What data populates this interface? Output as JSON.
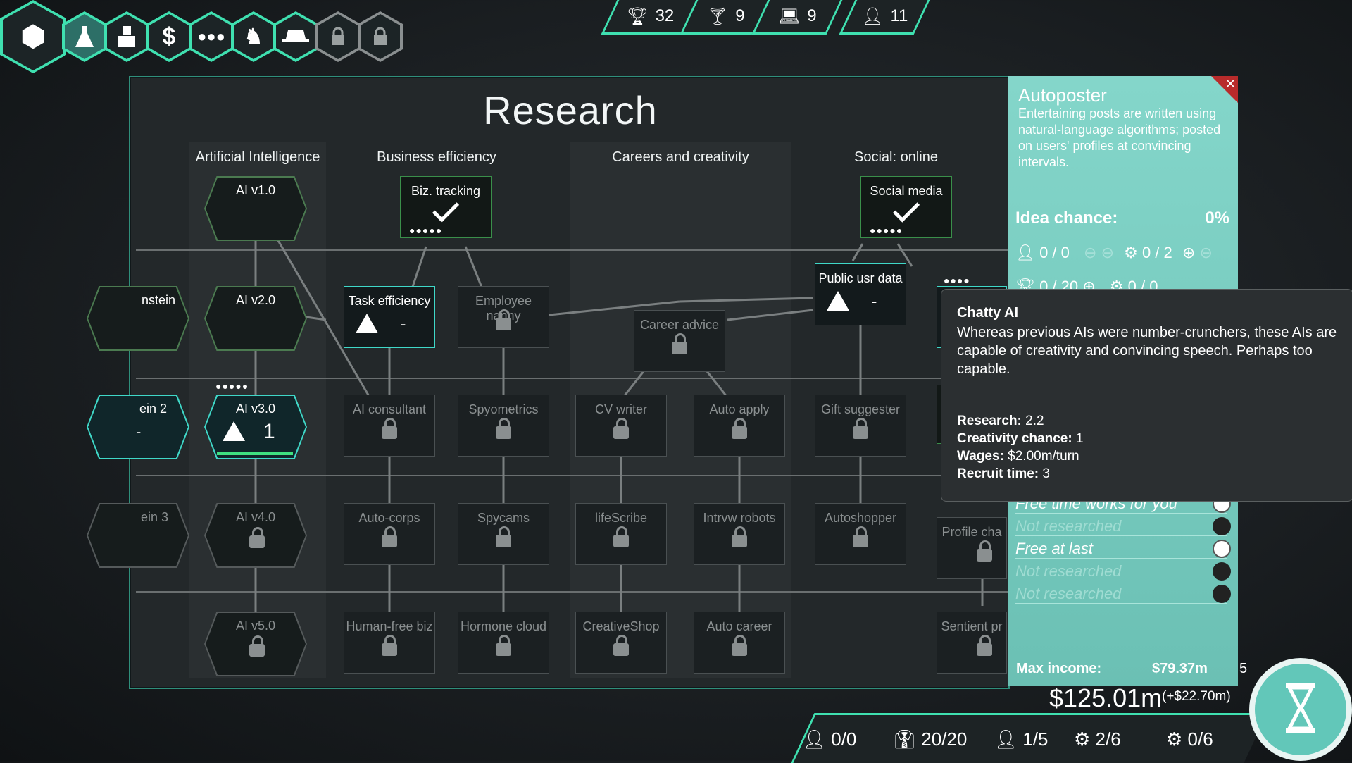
{
  "nav": {
    "items": [
      {
        "name": "home",
        "icon": "hexagons-icon"
      },
      {
        "name": "research",
        "icon": "flask-icon"
      },
      {
        "name": "staff",
        "icon": "person-icon"
      },
      {
        "name": "finance",
        "icon": "dollar-icon",
        "glyph": "$"
      },
      {
        "name": "population",
        "icon": "crowd-icon"
      },
      {
        "name": "strategy",
        "icon": "chess-knight-icon"
      },
      {
        "name": "spy",
        "icon": "spy-hat-icon"
      },
      {
        "name": "locked1",
        "icon": "padlock-icon"
      },
      {
        "name": "locked2",
        "icon": "padlock-icon"
      }
    ]
  },
  "resources": [
    {
      "icon": "trophy-icon",
      "value": "32"
    },
    {
      "icon": "cocktail-icon",
      "value": "9"
    },
    {
      "icon": "laptop-icon",
      "value": "9"
    },
    {
      "icon": "user-slot-icon",
      "value": "11"
    }
  ],
  "research": {
    "title": "Research",
    "columns": [
      "Artificial Intelligence",
      "Business efficiency",
      "Careers and creativity",
      "Social: online"
    ],
    "nodes": {
      "einstein": "nstein",
      "einstein2": "ein 2",
      "einstein2_dash": "-",
      "einstein3": "ein 3",
      "ai1": "AI v1.0",
      "ai2": "AI v2.0",
      "ai3": "AI v3.0",
      "ai3_level": "1",
      "ai4": "AI v4.0",
      "ai5": "AI v5.0",
      "biz": "Biz. tracking",
      "task": "Task efficiency",
      "task_dash": "-",
      "nanny": "Employee nanny",
      "consultant": "AI consultant",
      "spyometrics": "Spyometrics",
      "autocorps": "Auto-corps",
      "spycams": "Spycams",
      "humanfree": "Human-free biz",
      "hormone": "Hormone cloud",
      "career": "Career advice",
      "cv": "CV writer",
      "autoapply": "Auto apply",
      "lifescribe": "lifeScribe",
      "intrvw": "Intrvw robots",
      "creativeshop": "CreativeShop",
      "autocareer": "Auto career",
      "social": "Social media",
      "public": "Public usr data",
      "public_dash": "-",
      "gift": "Gift suggester",
      "autoshopper": "Autoshopper",
      "profile": "Profile cha",
      "sentient": "Sentient pr"
    }
  },
  "detail": {
    "name": "Autoposter",
    "description": "Entertaining posts are written using natural-language algorithms; posted on users' profiles at convincing intervals.",
    "idea_label": "Idea chance:",
    "idea_value": "0%",
    "row1_a": "0 / 0",
    "row1_b": "0 / 2",
    "row2_a": "0 / 20",
    "row2_b": "0 / 0",
    "slots": [
      "Free time works for you",
      "Not researched",
      "Free at last",
      "Not researched",
      "Not researched"
    ],
    "max_income_label": "Max income:",
    "max_income_value": "$79.37m",
    "edge_digit": "5"
  },
  "tooltip": {
    "title": "Chatty AI",
    "desc": "Whereas previous AIs were number-crunchers, these AIs are capable of creativity and convincing speech. Perhaps too capable.",
    "research_label": "Research:",
    "research_value": "2.2",
    "creativity_label": "Creativity chance:",
    "creativity_value": "1",
    "wages_label": "Wages:",
    "wages_value": "$2.00m/turn",
    "recruit_label": "Recruit time:",
    "recruit_value": "3"
  },
  "money": {
    "total": "$125.01m",
    "delta": "(+$22.70m)"
  },
  "bottom": [
    "0/0",
    "20/20",
    "1/5",
    "2/6",
    "0/6"
  ],
  "colors": {
    "accent": "#3fe0b0",
    "teal_panel": "#78cfc2",
    "close": "#b82b2b"
  }
}
